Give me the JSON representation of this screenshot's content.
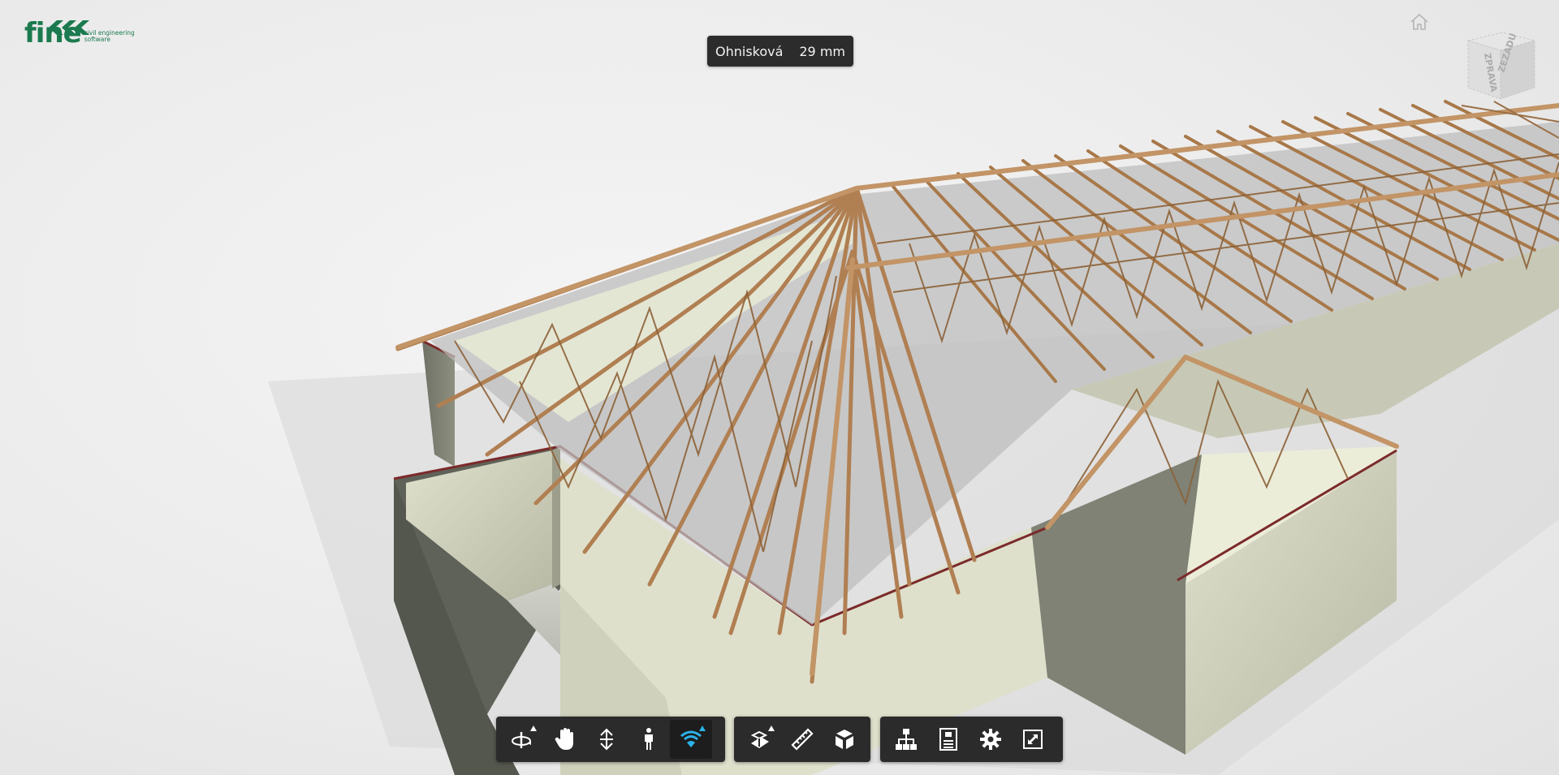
{
  "logo": {
    "word": "fine",
    "line1": "civil engineering",
    "line2": "software"
  },
  "focal": {
    "label": "Ohnisková",
    "value": "29 mm"
  },
  "viewcube": {
    "face_right": "ZPRAVA",
    "face_back": "ZEZADU"
  },
  "toolbar": {
    "group1": [
      "orbit-icon",
      "pan-hand-icon",
      "zoom-vertical-icon",
      "walk-person-icon",
      "fly-wifi-icon"
    ],
    "group2": [
      "section-cut-icon",
      "measure-ruler-icon",
      "explode-cube-icon"
    ],
    "group3": [
      "model-tree-icon",
      "properties-icon",
      "settings-gear-icon",
      "fullscreen-icon"
    ]
  },
  "colors": {
    "accent": "#2bb3e8",
    "brand": "#1b7a4f",
    "wood": "#b5885a",
    "wall": "#d8dac6",
    "toolbar": "#2b2b2b"
  }
}
